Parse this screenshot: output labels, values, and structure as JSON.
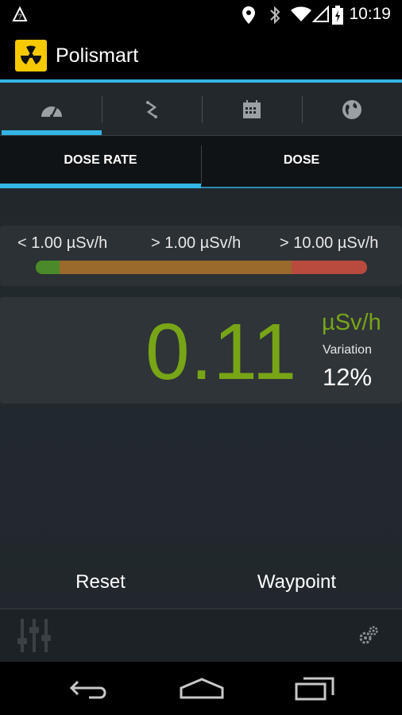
{
  "status_bar": {
    "time": "10:19"
  },
  "app": {
    "title": "Polismart",
    "accent": "#33b5e5",
    "value_color": "#78a516"
  },
  "icon_tabs": [
    {
      "icon": "speedometer-icon",
      "selected": true
    },
    {
      "icon": "shuffle-icon",
      "selected": false
    },
    {
      "icon": "calendar-icon",
      "selected": false
    },
    {
      "icon": "globe-icon",
      "selected": false
    }
  ],
  "text_tabs": {
    "dose_rate": "DOSE RATE",
    "dose": "DOSE",
    "selected": "DOSE RATE"
  },
  "legend": {
    "low": "< 1.00 µSv/h",
    "mid": "> 1.00 µSv/h",
    "high": "> 10.00 µSv/h",
    "colors": {
      "low": "#4a8a2a",
      "mid": "#9a6a2c",
      "high": "#b84a3e"
    }
  },
  "reading": {
    "value": "0.11",
    "unit": "µSv/h",
    "variation_label": "Variation",
    "variation_value": "12%"
  },
  "buttons": {
    "reset": "Reset",
    "waypoint": "Waypoint"
  },
  "toolbar": {
    "left_icon": "sliders-icon",
    "right_icon": "gears-icon"
  },
  "nav_bar": {
    "back": "back-icon",
    "home": "home-icon",
    "recents": "recents-icon"
  }
}
